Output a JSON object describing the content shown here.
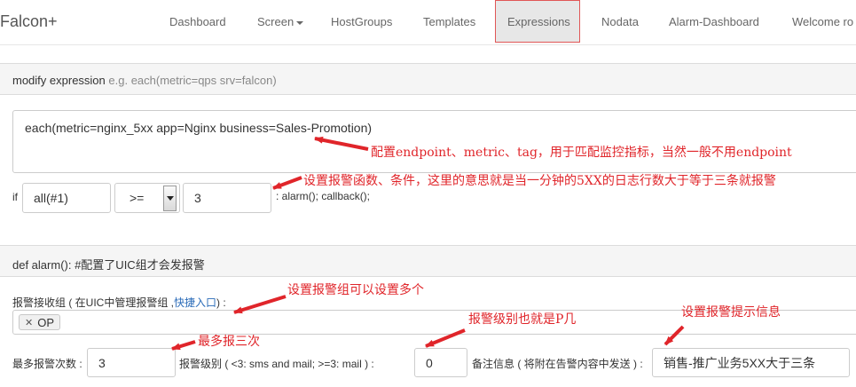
{
  "brand": "Falcon+",
  "nav": {
    "items": [
      {
        "label": "Dashboard"
      },
      {
        "label": "Screen"
      },
      {
        "label": "HostGroups"
      },
      {
        "label": "Templates"
      },
      {
        "label": "Expressions"
      },
      {
        "label": "Nodata"
      },
      {
        "label": "Alarm-Dashboard"
      },
      {
        "label": "Welcome ro"
      }
    ],
    "active": "Expressions"
  },
  "modify_panel": {
    "title": "modify expression",
    "hint": "e.g. each(metric=qps srv=falcon)",
    "expression": "each(metric=nginx_5xx app=Nginx business=Sales-Promotion)",
    "if_label": "if",
    "func_value": "all(#1)",
    "operator_value": ">=",
    "threshold_value": "3",
    "callback_text": ": alarm(); callback();"
  },
  "alarm_panel": {
    "title": "def alarm(): #配置了UIC组才会发报警",
    "receiver_label": "报警接收组 ( 在UIC中管理报警组 ,",
    "quick_link": "快捷入口",
    "receiver_label_end": ") :",
    "tags": [
      {
        "label": "OP"
      }
    ],
    "max_label": "最多报警次数 :",
    "max_value": "3",
    "level_label": "报警级别 ( <3: sms and mail; >=3: mail ) :",
    "level_value": "0",
    "note_label": "备注信息 ( 将附在告警内容中发送 ) :",
    "note_value": "销售-推广业务5XX大于三条"
  },
  "annotations": {
    "endpoint": "配置endpoint、metric、tag，用于匹配监控指标，当然一般不用endpoint",
    "function": "设置报警函数、条件，这里的意思就是当一分钟的5XX的日志行数大于等于三条就报警",
    "group": "设置报警组可以设置多个",
    "max": "最多报三次",
    "level": "报警级别也就是P几",
    "note": "设置报警提示信息"
  },
  "colors": {
    "annotation": "#e0252a",
    "active_border": "#e05656",
    "link": "#2a6bb8"
  }
}
